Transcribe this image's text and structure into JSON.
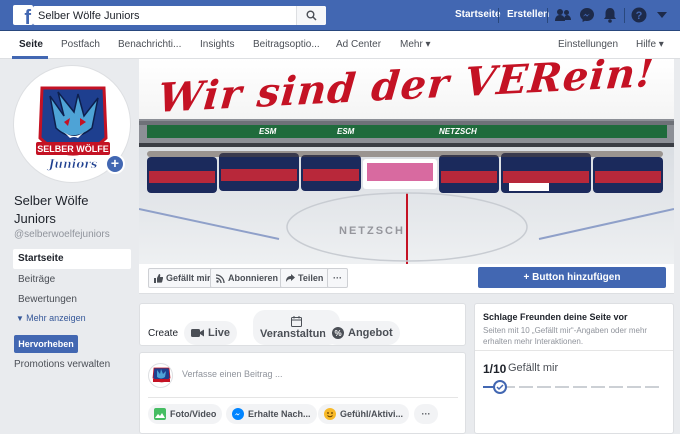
{
  "topbar": {
    "search_value": "Selber Wölfe Juniors",
    "home_link": "Startseite",
    "create_link": "Erstellen",
    "colors": {
      "brand": "#4267b2"
    },
    "icons": [
      "facebook-logo-icon",
      "search-icon",
      "friends-icon",
      "messenger-icon",
      "notifications-icon",
      "help-icon",
      "caret-down-icon"
    ]
  },
  "tabs": {
    "items": [
      "Seite",
      "Postfach",
      "Benachrichti...",
      "Insights",
      "Beitragsoptio...",
      "Ad Center",
      "Mehr ▾"
    ],
    "settings": "Einstellungen",
    "help": "Hilfe ▾"
  },
  "page": {
    "name": "Selber Wölfe Juniors",
    "handle": "@selberwoelfejuniors",
    "logo_text_top": "SELBER WÖLFE",
    "logo_text_bottom": "Juniors"
  },
  "nav": {
    "items": [
      "Startseite",
      "Beiträge",
      "Bewertungen"
    ],
    "more": "Mehr anzeigen",
    "promote": "Hervorheben",
    "manage_promotions": "Promotions verwalten"
  },
  "cover": {
    "headline": "Wir sind der VERein!",
    "board_texts": [
      "ESM",
      "ESM",
      "NETZSCH"
    ],
    "ice_logo": "NETZSCH"
  },
  "actions": {
    "like": "Gefällt mir",
    "follow": "Abonnieren",
    "share": "Teilen",
    "more": "···",
    "add_button": "+ Button hinzufügen"
  },
  "create": {
    "label": "Create",
    "live": "Live",
    "event": "Veranstaltung",
    "offer": "Angebot"
  },
  "composer": {
    "placeholder": "Verfasse einen Beitrag ...",
    "photo": "Foto/Video",
    "messages": "Erhalte Nach...",
    "feeling": "Gefühl/Aktivi...",
    "more": "···"
  },
  "invite": {
    "title": "Schlage Freunden deine Seite vor",
    "subtitle": "Seiten mit 10 „Gefällt mir“-Angaben oder mehr erhalten mehr Interaktionen.",
    "count": "1/10",
    "count_label": "Gefällt mir",
    "progress": 0.1
  }
}
